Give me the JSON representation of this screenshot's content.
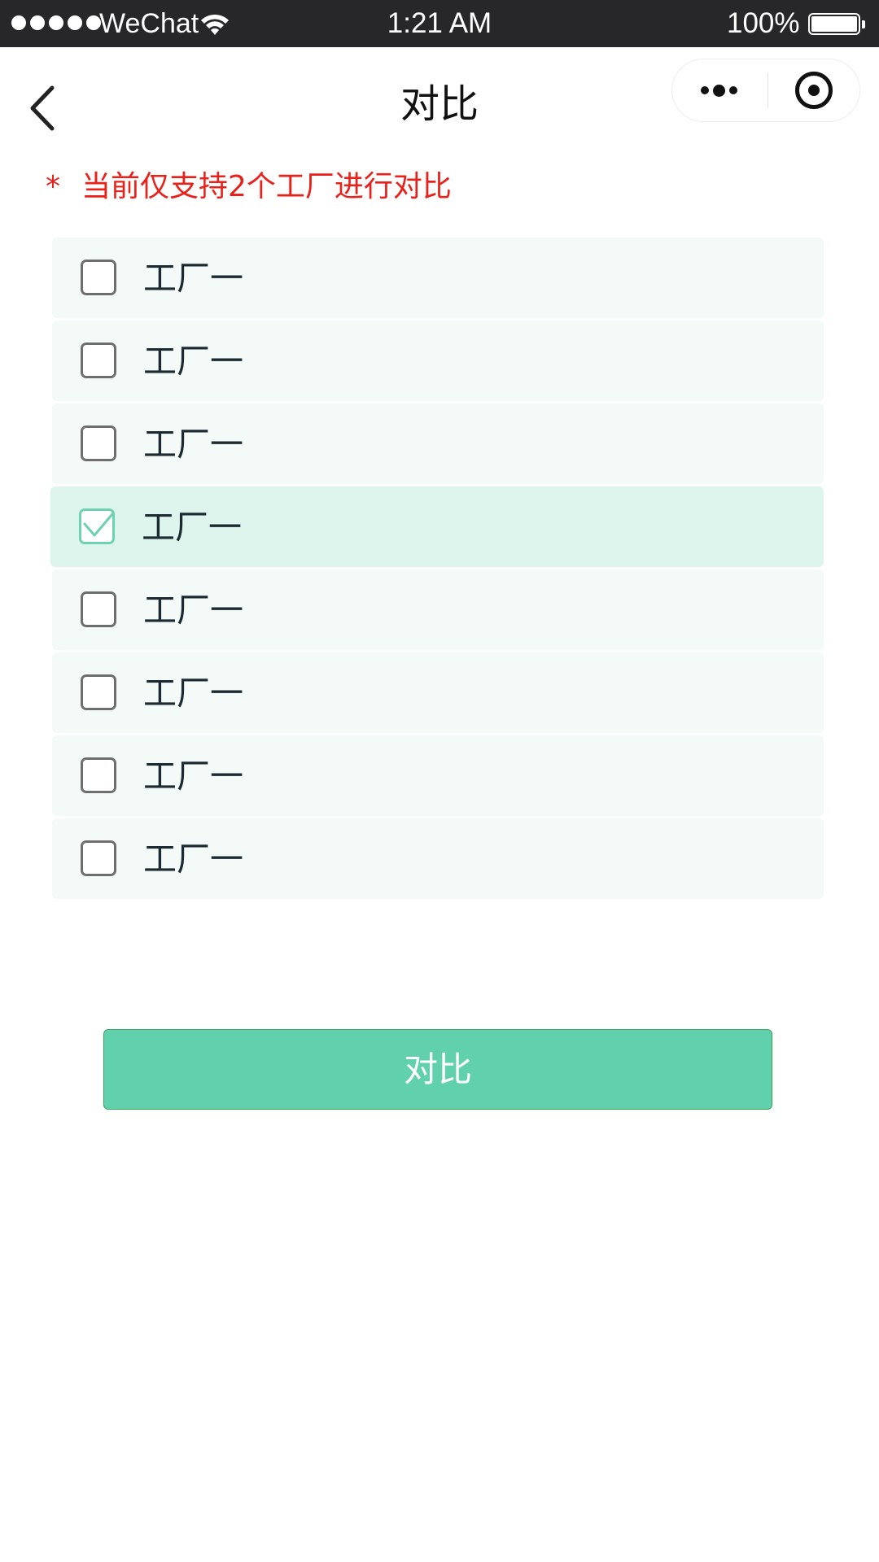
{
  "status_bar": {
    "carrier": "WeChat",
    "time": "1:21 AM",
    "battery": "100%",
    "signal_bars": 5,
    "wifi_icon": "wifi-icon",
    "battery_icon": "battery-icon"
  },
  "nav": {
    "title": "对比",
    "back_icon": "chevron-left-icon",
    "more_icon": "more-dots-icon",
    "close_icon": "target-close-icon"
  },
  "notice": {
    "asterisk": "*",
    "text": "当前仅支持2个工厂进行对比",
    "color": "#e8211a"
  },
  "factories": [
    {
      "label": "工厂一",
      "checked": false
    },
    {
      "label": "工厂一",
      "checked": false
    },
    {
      "label": "工厂一",
      "checked": false
    },
    {
      "label": "工厂一",
      "checked": true
    },
    {
      "label": "工厂一",
      "checked": false
    },
    {
      "label": "工厂一",
      "checked": false
    },
    {
      "label": "工厂一",
      "checked": false
    },
    {
      "label": "工厂一",
      "checked": false
    }
  ],
  "compare_button": {
    "label": "对比",
    "color": "#60d1ac"
  },
  "colors": {
    "accent": "#60d1ac",
    "row_bg": "#f4faf8",
    "selected_row_bg": "#def5ed"
  }
}
